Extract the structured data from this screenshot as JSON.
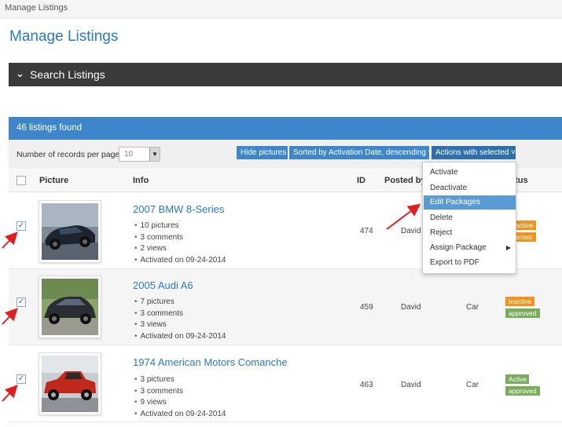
{
  "breadcrumb": "Manage Listings",
  "page_title": "Manage Listings",
  "search": {
    "label": "Search Listings"
  },
  "results": {
    "count_text": "46 listings found"
  },
  "controls": {
    "records_label": "Number of records per page",
    "records_value": "10",
    "hide_pictures": "Hide pictures",
    "sort": "Sorted by Activation Date, descending",
    "actions": "Actions with selected"
  },
  "columns": {
    "picture": "Picture",
    "info": "Info",
    "id": "ID",
    "posted_by": "Posted by",
    "status": "atus"
  },
  "dropdown": {
    "items": [
      "Activate",
      "Deactivate",
      "Edit Packages",
      "Delete",
      "Reject",
      "Assign Package",
      "Export to PDF"
    ],
    "highlighted": "Edit Packages"
  },
  "listings": [
    {
      "title": "2007 BMW 8-Series",
      "meta": [
        "10 pictures",
        "3 comments",
        "2 views",
        "Activated on 09-24-2014"
      ],
      "id": "474",
      "posted_by": "David",
      "category": "",
      "status": [
        "active",
        "ected"
      ],
      "checked": true
    },
    {
      "title": "2005 Audi A6",
      "meta": [
        "7 pictures",
        "3 comments",
        "3 views",
        "Activated on 09-24-2014"
      ],
      "id": "459",
      "posted_by": "David",
      "category": "Car",
      "status": [
        "Inactive",
        "approved"
      ],
      "checked": true
    },
    {
      "title": "1974 American Motors Comanche",
      "meta": [
        "3 pictures",
        "3 comments",
        "9 views",
        "Activated on 09-24-2014"
      ],
      "id": "463",
      "posted_by": "David",
      "category": "Car",
      "status": [
        "Active",
        "approved"
      ],
      "checked": true
    }
  ],
  "colors": {
    "accent": "#3e86cb",
    "link": "#2a7ac0",
    "dark_bar": "#3a3a3a",
    "inactive": "#f0941e",
    "approved": "#79ad5c",
    "arrow": "#e02020"
  }
}
